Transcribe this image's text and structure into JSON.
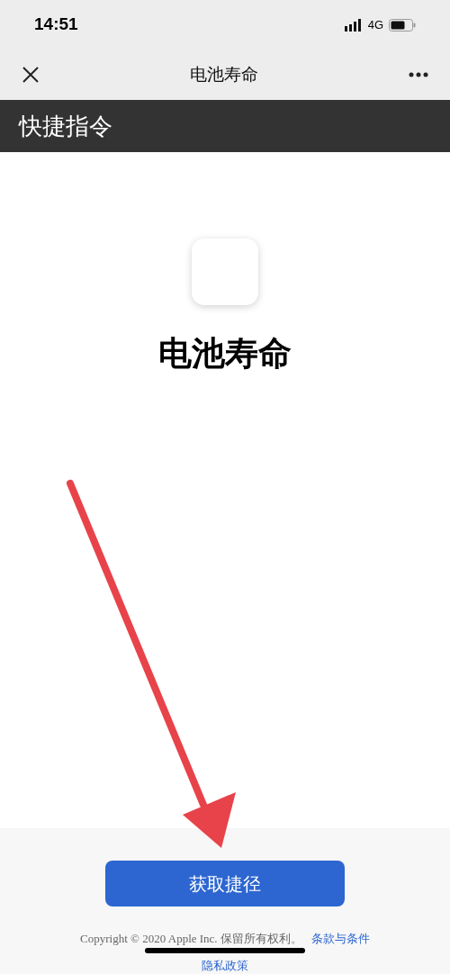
{
  "status_bar": {
    "time": "14:51",
    "network": "4G"
  },
  "nav_bar": {
    "title": "电池寿命"
  },
  "header": {
    "title": "快捷指令"
  },
  "shortcut": {
    "name": "电池寿命"
  },
  "button": {
    "label": "获取捷径"
  },
  "footer": {
    "copyright": "Copyright © 2020 Apple Inc. 保留所有权利。",
    "links": [
      "条款与条件",
      "隐私政策"
    ]
  }
}
